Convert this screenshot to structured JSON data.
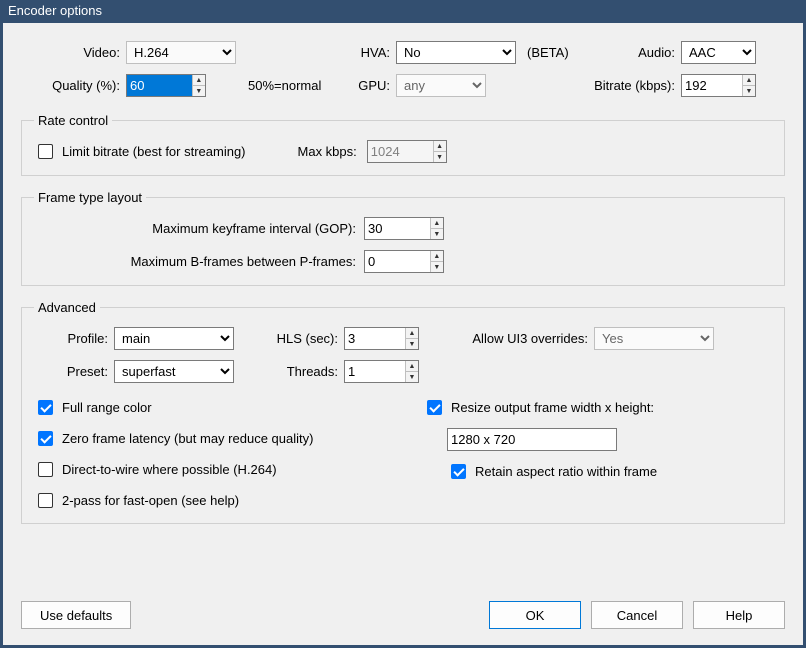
{
  "title": "Encoder options",
  "top": {
    "video_label": "Video:",
    "video_value": "H.264",
    "hva_label": "HVA:",
    "hva_value": "No",
    "hva_beta": "(BETA)",
    "audio_label": "Audio:",
    "audio_value": "AAC",
    "quality_label": "Quality (%):",
    "quality_value": "60",
    "quality_note": "50%=normal",
    "gpu_label": "GPU:",
    "gpu_value": "any",
    "bitrate_label": "Bitrate (kbps):",
    "bitrate_value": "192"
  },
  "rate": {
    "legend": "Rate control",
    "limit_label": "Limit bitrate (best for streaming)",
    "limit_checked": false,
    "maxkbps_label": "Max kbps:",
    "maxkbps_value": "1024"
  },
  "ftl": {
    "legend": "Frame type layout",
    "gop_label": "Maximum keyframe interval (GOP):",
    "gop_value": "30",
    "bframes_label": "Maximum B-frames between P-frames:",
    "bframes_value": "0"
  },
  "adv": {
    "legend": "Advanced",
    "profile_label": "Profile:",
    "profile_value": "main",
    "hls_label": "HLS (sec):",
    "hls_value": "3",
    "allow_ui3_label": "Allow UI3 overrides:",
    "allow_ui3_value": "Yes",
    "preset_label": "Preset:",
    "preset_value": "superfast",
    "threads_label": "Threads:",
    "threads_value": "1",
    "full_range_label": "Full range color",
    "full_range_checked": true,
    "zero_latency_label": "Zero frame latency (but may reduce quality)",
    "zero_latency_checked": true,
    "direct_wire_label": "Direct-to-wire where possible (H.264)",
    "direct_wire_checked": false,
    "two_pass_label": "2-pass for fast-open (see help)",
    "two_pass_checked": false,
    "resize_label": "Resize output frame width x height:",
    "resize_checked": true,
    "resize_value": "1280 x 720",
    "retain_aspect_label": "Retain aspect ratio within frame",
    "retain_aspect_checked": true
  },
  "buttons": {
    "defaults": "Use defaults",
    "ok": "OK",
    "cancel": "Cancel",
    "help": "Help"
  }
}
